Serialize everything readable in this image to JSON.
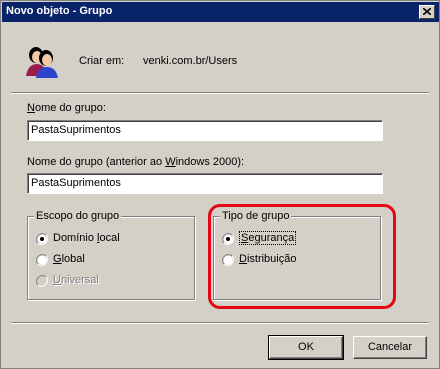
{
  "window": {
    "title": "Novo objeto - Grupo"
  },
  "header": {
    "create_in_label": "Criar em:",
    "create_in_value": "venki.com.br/Users",
    "icon": "users-icon"
  },
  "group_name": {
    "label_prefix": "",
    "label_accel": "N",
    "label_rest": "ome do grupo:",
    "value": "PastaSuprimentos"
  },
  "group_name_legacy": {
    "label_before": "Nome do grupo (anterior ao ",
    "label_accel": "W",
    "label_after": "indows 2000):",
    "value": "PastaSuprimentos"
  },
  "scope": {
    "title": "Escopo do grupo",
    "options": [
      {
        "before": "Domínio ",
        "accel": "l",
        "after": "ocal",
        "selected": true,
        "disabled": false
      },
      {
        "before": "",
        "accel": "G",
        "after": "lobal",
        "selected": false,
        "disabled": false
      },
      {
        "before": "",
        "accel": "U",
        "after": "niversal",
        "selected": false,
        "disabled": true
      }
    ]
  },
  "type": {
    "title": "Tipo de grupo",
    "options": [
      {
        "before": "",
        "accel": "S",
        "after": "egurança",
        "selected": true,
        "disabled": false
      },
      {
        "before": "",
        "accel": "D",
        "after": "istribuição",
        "selected": false,
        "disabled": false
      }
    ]
  },
  "buttons": {
    "ok": "OK",
    "cancel": "Cancelar"
  },
  "colors": {
    "titlebar": "#0a246a",
    "dialog_bg": "#d4d0c8",
    "highlight": "#e30613"
  }
}
